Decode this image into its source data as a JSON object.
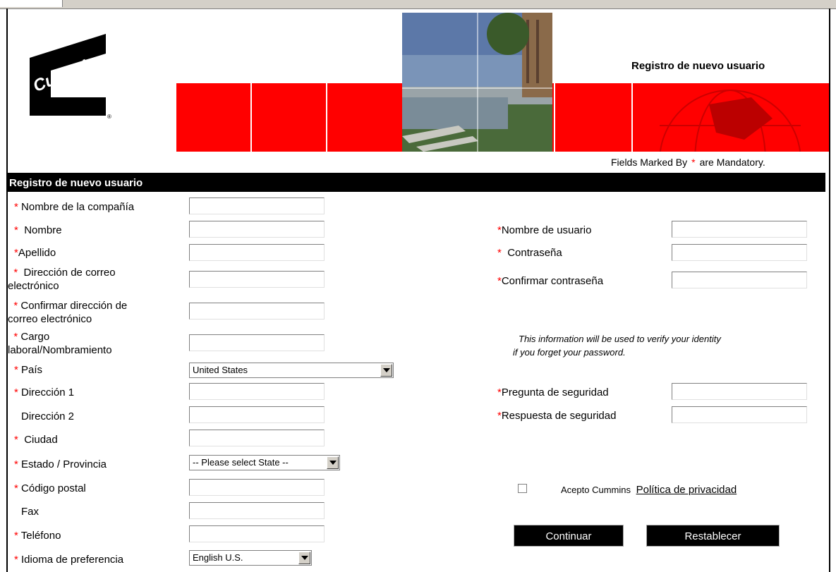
{
  "header": {
    "title": "Registro de nuevo usuario",
    "mandatory_prefix": "Fields Marked By",
    "mandatory_star": "*",
    "mandatory_suffix": "are Mandatory."
  },
  "section": {
    "title": "Registro de nuevo usuario"
  },
  "left_fields": [
    {
      "label": "Nombre de la compañía",
      "required": true
    },
    {
      "label": "Nombre",
      "required": true
    },
    {
      "label": "Apellido",
      "required": true
    },
    {
      "label": "Dirección de correo electrónico",
      "required": true
    },
    {
      "label": "Confirmar dirección de correo electrónico",
      "required": true
    },
    {
      "label": "Cargo laboral/Nombramiento",
      "required": true
    },
    {
      "label": "País",
      "required": true,
      "value": "United States"
    },
    {
      "label": "Dirección 1",
      "required": true
    },
    {
      "label": "Dirección 2",
      "required": false
    },
    {
      "label": "Ciudad",
      "required": true
    },
    {
      "label": "Estado / Provincia",
      "required": true,
      "value": "-- Please select State --"
    },
    {
      "label": "Código postal",
      "required": true
    },
    {
      "label": "Fax",
      "required": false
    },
    {
      "label": "Teléfono",
      "required": true
    },
    {
      "label": "Idioma de preferencia",
      "required": true,
      "value": "English U.S."
    }
  ],
  "right_fields": [
    {
      "label": "Nombre de usuario",
      "required": true
    },
    {
      "label": "Contraseña",
      "required": true
    },
    {
      "label": "Confirmar contraseña",
      "required": true
    },
    {
      "label": "Pregunta de seguridad",
      "required": true
    },
    {
      "label": "Respuesta de seguridad",
      "required": true
    }
  ],
  "info_text": {
    "line1": "This information will be used to verify your identity",
    "line2": "if you forget your password."
  },
  "privacy": {
    "prefix": "Acepto Cummins",
    "link": "Política de privacidad",
    "checked": false
  },
  "buttons": {
    "continue": "Continuar",
    "reset": "Restablecer"
  },
  "colors": {
    "brand_red": "#ff0000",
    "required_star": "#ff0000",
    "bar": "#000000"
  },
  "icons": [
    "cummins-logo",
    "chevron-down-icon"
  ]
}
